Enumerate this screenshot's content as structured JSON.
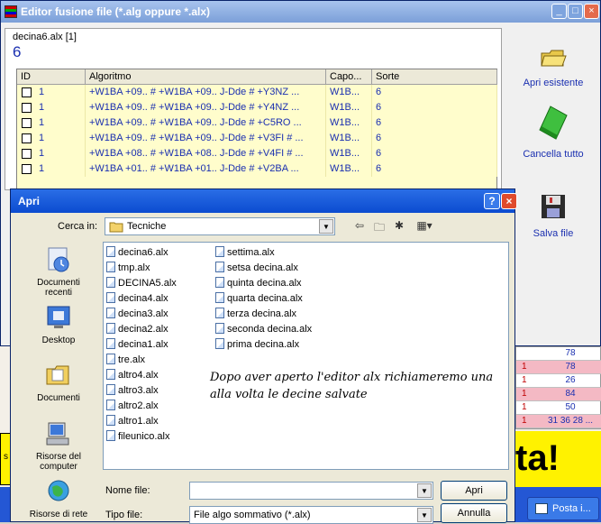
{
  "editor": {
    "title": "Editor fusione file (*.alg oppure *.alx)",
    "file_tab": "decina6.alx   [1]",
    "count": "6",
    "columns": [
      "ID",
      "Algoritmo",
      "Capo...",
      "Sorte"
    ],
    "rows": [
      {
        "id": "1",
        "algo": "+W1BA +09.. # +W1BA +09.. J-Dde # +Y3NZ ...",
        "capo": "W1B...",
        "sorte": "6"
      },
      {
        "id": "1",
        "algo": "+W1BA +09.. # +W1BA +09.. J-Dde # +Y4NZ ...",
        "capo": "W1B...",
        "sorte": "6"
      },
      {
        "id": "1",
        "algo": "+W1BA +09.. # +W1BA +09.. J-Dde # +C5RO ...",
        "capo": "W1B...",
        "sorte": "6"
      },
      {
        "id": "1",
        "algo": "+W1BA +09.. # +W1BA +09.. J-Dde # +V3FI # ...",
        "capo": "W1B...",
        "sorte": "6"
      },
      {
        "id": "1",
        "algo": "+W1BA +08.. # +W1BA +08.. J-Dde # +V4FI # ...",
        "capo": "W1B...",
        "sorte": "6"
      },
      {
        "id": "1",
        "algo": "+W1BA +01.. # +W1BA +01.. J-Dde # +V2BA ...",
        "capo": "W1B...",
        "sorte": "6"
      }
    ],
    "side_buttons": {
      "open": "Apri esistente",
      "clear": "Cancella tutto",
      "save": "Salva file"
    }
  },
  "dialog": {
    "title": "Apri",
    "look_in_label": "Cerca in:",
    "look_in_value": "Tecniche",
    "places": [
      "Documenti recenti",
      "Desktop",
      "Documenti",
      "Risorse del computer",
      "Risorse di rete"
    ],
    "files_col1": [
      "decina6.alx",
      "tmp.alx",
      "DECINA5.alx",
      "decina4.alx",
      "decina3.alx",
      "decina2.alx",
      "decina1.alx",
      "tre.alx",
      "altro4.alx",
      "altro3.alx",
      "altro2.alx",
      "altro1.alx",
      "fileunico.alx"
    ],
    "files_col2": [
      "settima.alx",
      "setsa decina.alx",
      "quinta decina.alx",
      "quarta decina.alx",
      "terza decina.alx",
      "seconda decina.alx",
      "prima decina.alx"
    ],
    "note": "Dopo aver aperto l'editor alx richiameremo una alla volta le decine salvate",
    "filename_label": "Nome file:",
    "filename_value": "",
    "filetype_label": "Tipo file:",
    "filetype_value": "File algo sommativo (*.alx)",
    "open_button": "Apri",
    "cancel_button": "Annulla"
  },
  "background": {
    "table_rows": [
      {
        "a": "",
        "b": "78"
      },
      {
        "a": "1",
        "b": "78"
      },
      {
        "a": "1",
        "b": "26"
      },
      {
        "a": "1",
        "b": "84"
      },
      {
        "a": "1",
        "b": "50"
      },
      {
        "a": "1",
        "b": "31 36 28 ..."
      }
    ],
    "big_text": "ta!",
    "left_stub": "s",
    "taskbar_button": "Posta i..."
  }
}
